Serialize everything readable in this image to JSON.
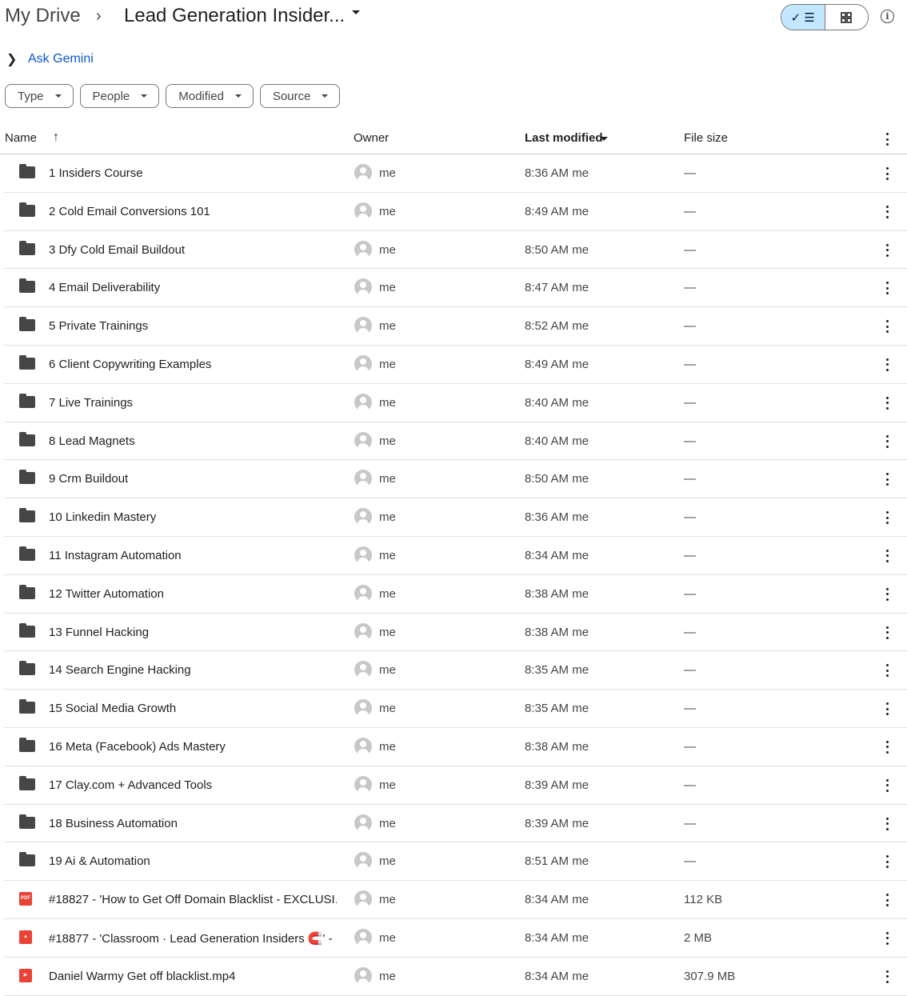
{
  "header": {
    "breadcrumb_root": "My Drive",
    "breadcrumb_sep": "›",
    "breadcrumb_current": "Lead Generation Insider...",
    "info_glyph": "i"
  },
  "gemini": {
    "label": "Ask Gemini"
  },
  "filters": [
    "Type",
    "People",
    "Modified",
    "Source"
  ],
  "columns": {
    "name": "Name",
    "owner": "Owner",
    "modified": "Last modified",
    "size": "File size"
  },
  "rows": [
    {
      "name": "1 Insiders Course",
      "owner": "me",
      "modified": "8:36 AM me",
      "size": "—",
      "type": "folder"
    },
    {
      "name": "2 Cold Email Conversions 101",
      "owner": "me",
      "modified": "8:49 AM me",
      "size": "—",
      "type": "folder"
    },
    {
      "name": "3 Dfy Cold Email Buildout",
      "owner": "me",
      "modified": "8:50 AM me",
      "size": "—",
      "type": "folder"
    },
    {
      "name": "4 Email Deliverability",
      "owner": "me",
      "modified": "8:47 AM me",
      "size": "—",
      "type": "folder"
    },
    {
      "name": "5 Private Trainings",
      "owner": "me",
      "modified": "8:52 AM me",
      "size": "—",
      "type": "folder"
    },
    {
      "name": "6 Client Copywriting Examples",
      "owner": "me",
      "modified": "8:49 AM me",
      "size": "—",
      "type": "folder"
    },
    {
      "name": "7 Live Trainings",
      "owner": "me",
      "modified": "8:40 AM me",
      "size": "—",
      "type": "folder"
    },
    {
      "name": "8 Lead Magnets",
      "owner": "me",
      "modified": "8:40 AM me",
      "size": "—",
      "type": "folder"
    },
    {
      "name": "9 Crm Buildout",
      "owner": "me",
      "modified": "8:50 AM me",
      "size": "—",
      "type": "folder"
    },
    {
      "name": "10 Linkedin Mastery",
      "owner": "me",
      "modified": "8:36 AM me",
      "size": "—",
      "type": "folder"
    },
    {
      "name": "11 Instagram Automation",
      "owner": "me",
      "modified": "8:34 AM me",
      "size": "—",
      "type": "folder"
    },
    {
      "name": "12 Twitter Automation",
      "owner": "me",
      "modified": "8:38 AM me",
      "size": "—",
      "type": "folder"
    },
    {
      "name": "13 Funnel Hacking",
      "owner": "me",
      "modified": "8:38 AM me",
      "size": "—",
      "type": "folder"
    },
    {
      "name": "14 Search Engine Hacking",
      "owner": "me",
      "modified": "8:35 AM me",
      "size": "—",
      "type": "folder"
    },
    {
      "name": "15 Social Media Growth",
      "owner": "me",
      "modified": "8:35 AM me",
      "size": "—",
      "type": "folder"
    },
    {
      "name": "16 Meta (Facebook) Ads Mastery",
      "owner": "me",
      "modified": "8:38 AM me",
      "size": "—",
      "type": "folder"
    },
    {
      "name": "17 Clay.com + Advanced Tools",
      "owner": "me",
      "modified": "8:39 AM me",
      "size": "—",
      "type": "folder"
    },
    {
      "name": "18 Business Automation",
      "owner": "me",
      "modified": "8:39 AM me",
      "size": "—",
      "type": "folder"
    },
    {
      "name": "19 Ai & Automation",
      "owner": "me",
      "modified": "8:51 AM me",
      "size": "—",
      "type": "folder"
    },
    {
      "name": "#18827 - 'How to Get Off Domain Blacklist - EXCLUSI...",
      "owner": "me",
      "modified": "8:34 AM me",
      "size": "112 KB",
      "type": "pdf",
      "icon_text": "PDF"
    },
    {
      "name": "#18877 - 'Classroom · Lead Generation Insiders 🧲' - ...",
      "owner": "me",
      "modified": "8:34 AM me",
      "size": "2 MB",
      "type": "img",
      "icon_text": "▲"
    },
    {
      "name": "Daniel Warmy Get off blacklist.mp4",
      "owner": "me",
      "modified": "8:34 AM me",
      "size": "307.9 MB",
      "type": "vid",
      "icon_text": "▶"
    }
  ],
  "icons": {
    "list_view": "✓ ☰",
    "grid_view": "grid-icon",
    "more": "more-vert-icon"
  }
}
